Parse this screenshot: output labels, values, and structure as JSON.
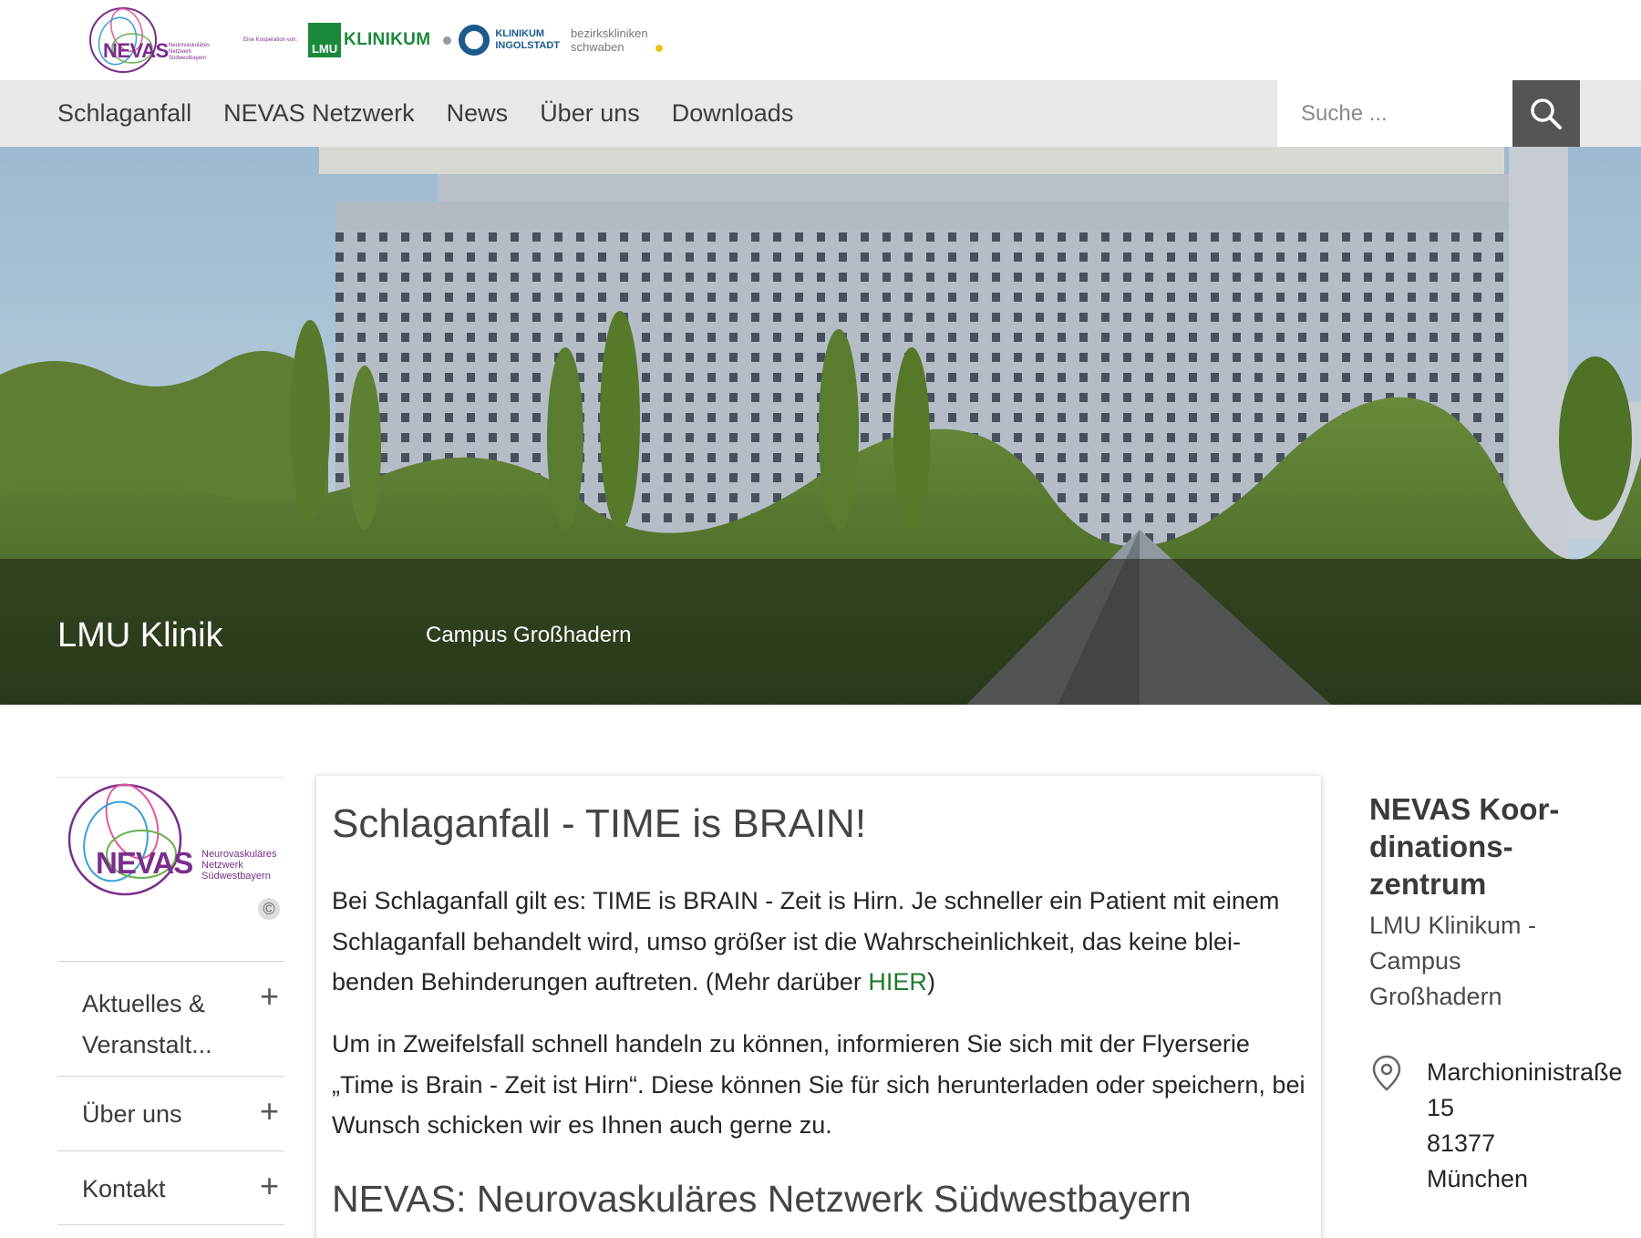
{
  "header": {
    "nevas_logo_text": "NEVAS",
    "nevas_logo_sub": "Neurovaskuläres Netzwerk Südwestbayern",
    "kooperation_text": "Eine Kooperation von:",
    "lmu_box": "LMU",
    "lmu_text": "KLINIKUM",
    "ingolstadt_line1": "KLINIKUM",
    "ingolstadt_line2": "INGOLSTADT",
    "bezirk_line1": "bezirkskliniken",
    "bezirk_line2": "schwaben"
  },
  "nav": {
    "items": [
      {
        "label": "Schlaganfall"
      },
      {
        "label": "NEVAS Netzwerk"
      },
      {
        "label": "News"
      },
      {
        "label": "Über uns"
      },
      {
        "label": "Downloads"
      }
    ],
    "search_placeholder": "Suche ...",
    "search_icon": "search-icon"
  },
  "hero": {
    "title": "LMU Klinik",
    "subtitle": "Campus Großhadern"
  },
  "sidebar": {
    "logo_text": "NEVAS",
    "logo_sub": "Neurovaskuläres Netzwerk Südwestbayern",
    "copyright_symbol": "©",
    "items": [
      {
        "label": "Aktuelles & Veranstalt...",
        "expand": "+"
      },
      {
        "label": "Über uns",
        "expand": "+"
      },
      {
        "label": "Kontakt",
        "expand": "+"
      }
    ]
  },
  "main": {
    "title": "Schlaganfall - TIME is BRAIN!",
    "p1_before": "Bei Schlaganfall gilt es: TIME is BRAIN - Zeit is Hirn. Je schneller ein Patient mit einem Schlaganfall behandelt wird, umso größer ist die Wahrscheinlichkeit, das keine blei-benden Behinderungen auftreten. (Mehr darüber ",
    "p1_link": "HIER",
    "p1_after": ")",
    "p2": "Um in Zweifelsfall schnell handeln zu können, informieren Sie sich mit der Flyerserie „Time is Brain - Zeit ist Hirn“. Diese können Sie für sich herunterladen oder speichern, bei Wunsch schicken wir es Ihnen auch gerne zu.",
    "subtitle": "NEVAS: Neurovaskuläres Netzwerk Südwestbayern"
  },
  "right": {
    "title_l1": "NEVAS Koor-",
    "title_l2": "dinations-",
    "title_l3": "zentrum",
    "sub_l1": "LMU Klinikum -",
    "sub_l2": "Campus",
    "sub_l3": "Großhadern",
    "addr_l1": "Marchioninistraße",
    "addr_l2": "15",
    "addr_l3": "81377",
    "addr_l4": "München",
    "location_icon": "location-pin-icon"
  },
  "colors": {
    "nevas_purple": "#7a2e8c",
    "lmu_green": "#1a8a3a",
    "link_green": "#1e7b2c",
    "nav_bg": "#e8e8e8",
    "search_btn": "#555555"
  }
}
